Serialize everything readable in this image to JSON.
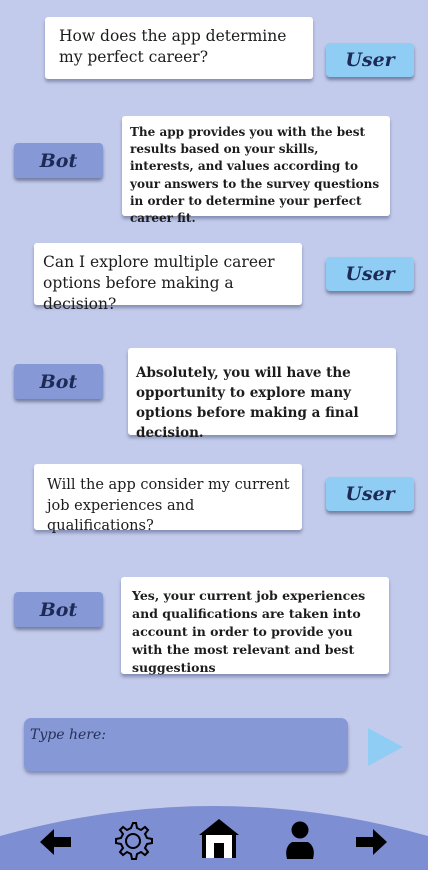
{
  "conversation": [
    {
      "role_label": "User",
      "text": "How does the app determine my perfect career?"
    },
    {
      "role_label": "Bot",
      "text": "The app provides you with the best results based on your skills, interests, and values according to your answers to the survey questions in order to determine your perfect career fit."
    },
    {
      "role_label": "User",
      "text": "Can I explore multiple career options before making a decision?"
    },
    {
      "role_label": "Bot",
      "text": "Absolutely, you will have the opportunity to explore many options before making a final decision."
    },
    {
      "role_label": "User",
      "text": "Will the app consider my current job experiences and qualifications?"
    },
    {
      "role_label": "Bot",
      "text": "Yes, your current job experiences and qualifications are taken into account in order to provide you with the most relevant and best suggestions"
    }
  ],
  "composer": {
    "placeholder": "Type here:"
  },
  "nav": {
    "icons": [
      "back-arrow-icon",
      "gear-icon",
      "home-icon",
      "person-icon",
      "forward-arrow-icon"
    ]
  },
  "colors": {
    "background": "#c3cbec",
    "user_tag": "#8fcdf4",
    "bot_tag": "#8698d6",
    "input": "#8698d6",
    "nav_bar": "#7e8ed3",
    "send_button": "#8fcdf4"
  }
}
